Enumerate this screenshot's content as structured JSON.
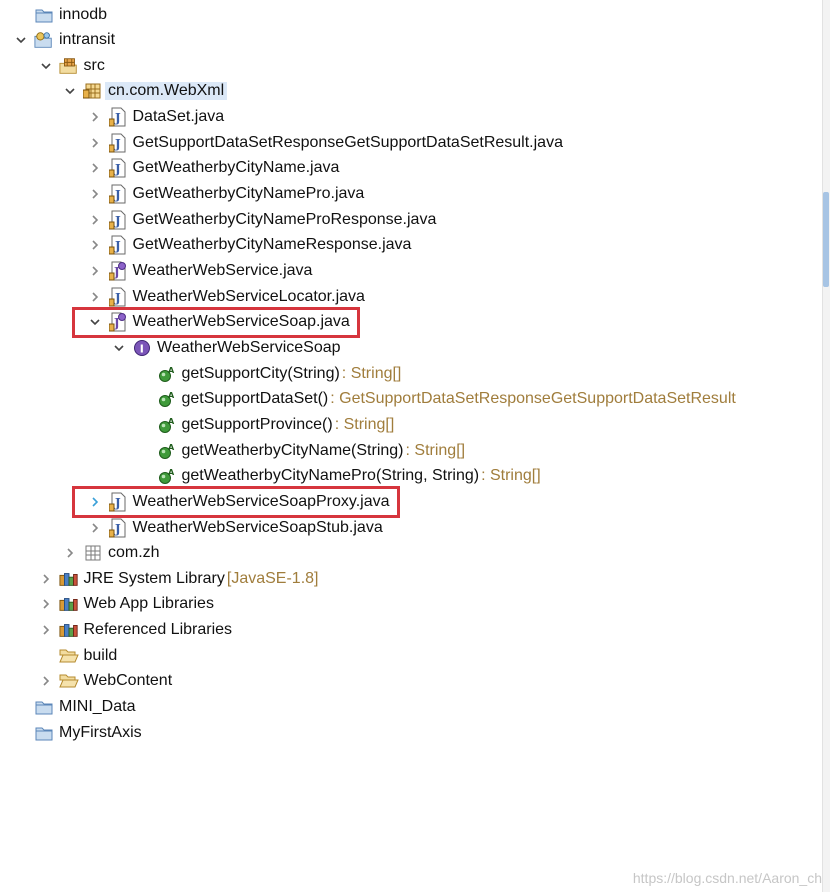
{
  "tree": [
    {
      "label": "innodb",
      "icon": "folder-icon",
      "depth": 0,
      "twisty": "none"
    },
    {
      "label": "intransit",
      "icon": "project-icon",
      "depth": 0,
      "twisty": "expanded"
    },
    {
      "label": "src",
      "icon": "source-folder-icon",
      "depth": 1,
      "twisty": "expanded"
    },
    {
      "label": "cn.com.WebXml",
      "icon": "package-icon",
      "depth": 2,
      "twisty": "expanded",
      "selected": true
    },
    {
      "label": "DataSet.java",
      "icon": "java-file-icon",
      "depth": 3,
      "twisty": "collapsed"
    },
    {
      "label": "GetSupportDataSetResponseGetSupportDataSetResult.java",
      "icon": "java-file-icon",
      "depth": 3,
      "twisty": "collapsed"
    },
    {
      "label": "GetWeatherbyCityName.java",
      "icon": "java-file-icon",
      "depth": 3,
      "twisty": "collapsed"
    },
    {
      "label": "GetWeatherbyCityNamePro.java",
      "icon": "java-file-icon",
      "depth": 3,
      "twisty": "collapsed"
    },
    {
      "label": "GetWeatherbyCityNameProResponse.java",
      "icon": "java-file-icon",
      "depth": 3,
      "twisty": "collapsed"
    },
    {
      "label": "GetWeatherbyCityNameResponse.java",
      "icon": "java-file-icon",
      "depth": 3,
      "twisty": "collapsed"
    },
    {
      "label": "WeatherWebService.java",
      "icon": "java-interface-file-icon",
      "depth": 3,
      "twisty": "collapsed"
    },
    {
      "label": "WeatherWebServiceLocator.java",
      "icon": "java-file-icon",
      "depth": 3,
      "twisty": "collapsed"
    },
    {
      "label": "WeatherWebServiceSoap.java",
      "icon": "java-interface-file-icon",
      "depth": 3,
      "twisty": "expanded",
      "highlight": true
    },
    {
      "label": "WeatherWebServiceSoap",
      "icon": "interface-icon",
      "depth": 4,
      "twisty": "expanded"
    },
    {
      "label": "getSupportCity(String)",
      "decor": ": String[]",
      "icon": "abstract-method-icon",
      "depth": 5,
      "twisty": "none"
    },
    {
      "label": "getSupportDataSet()",
      "decor": ": GetSupportDataSetResponseGetSupportDataSetResult",
      "icon": "abstract-method-icon",
      "depth": 5,
      "twisty": "none"
    },
    {
      "label": "getSupportProvince()",
      "decor": ": String[]",
      "icon": "abstract-method-icon",
      "depth": 5,
      "twisty": "none"
    },
    {
      "label": "getWeatherbyCityName(String)",
      "decor": ": String[]",
      "icon": "abstract-method-icon",
      "depth": 5,
      "twisty": "none"
    },
    {
      "label": "getWeatherbyCityNamePro(String, String)",
      "decor": ": String[]",
      "icon": "abstract-method-icon",
      "depth": 5,
      "twisty": "none"
    },
    {
      "label": "WeatherWebServiceSoapProxy.java",
      "icon": "java-file-icon",
      "depth": 3,
      "twisty": "collapsed-hover",
      "highlight": true
    },
    {
      "label": "WeatherWebServiceSoapStub.java",
      "icon": "java-file-icon",
      "depth": 3,
      "twisty": "collapsed"
    },
    {
      "label": "com.zh",
      "icon": "empty-package-icon",
      "depth": 2,
      "twisty": "collapsed"
    },
    {
      "label": "JRE System Library",
      "decor": "[JavaSE-1.8]",
      "icon": "library-icon",
      "depth": 1,
      "twisty": "collapsed"
    },
    {
      "label": "Web App Libraries",
      "icon": "library-icon",
      "depth": 1,
      "twisty": "collapsed"
    },
    {
      "label": "Referenced Libraries",
      "icon": "library-icon",
      "depth": 1,
      "twisty": "collapsed"
    },
    {
      "label": "build",
      "icon": "open-folder-icon",
      "depth": 1,
      "twisty": "none"
    },
    {
      "label": "WebContent",
      "icon": "open-folder-icon",
      "depth": 1,
      "twisty": "collapsed"
    },
    {
      "label": "MINI_Data",
      "icon": "folder-icon",
      "depth": 0,
      "twisty": "none"
    },
    {
      "label": "MyFirstAxis",
      "icon": "folder-icon",
      "depth": 0,
      "twisty": "none"
    }
  ],
  "watermark": "https://blog.csdn.net/Aaron_ch",
  "colors": {
    "highlight_box": "#d6353d",
    "decoration_text": "#a07d3c",
    "selection": "#dbe8f7",
    "twisty_hover": "#3aa0d8"
  }
}
